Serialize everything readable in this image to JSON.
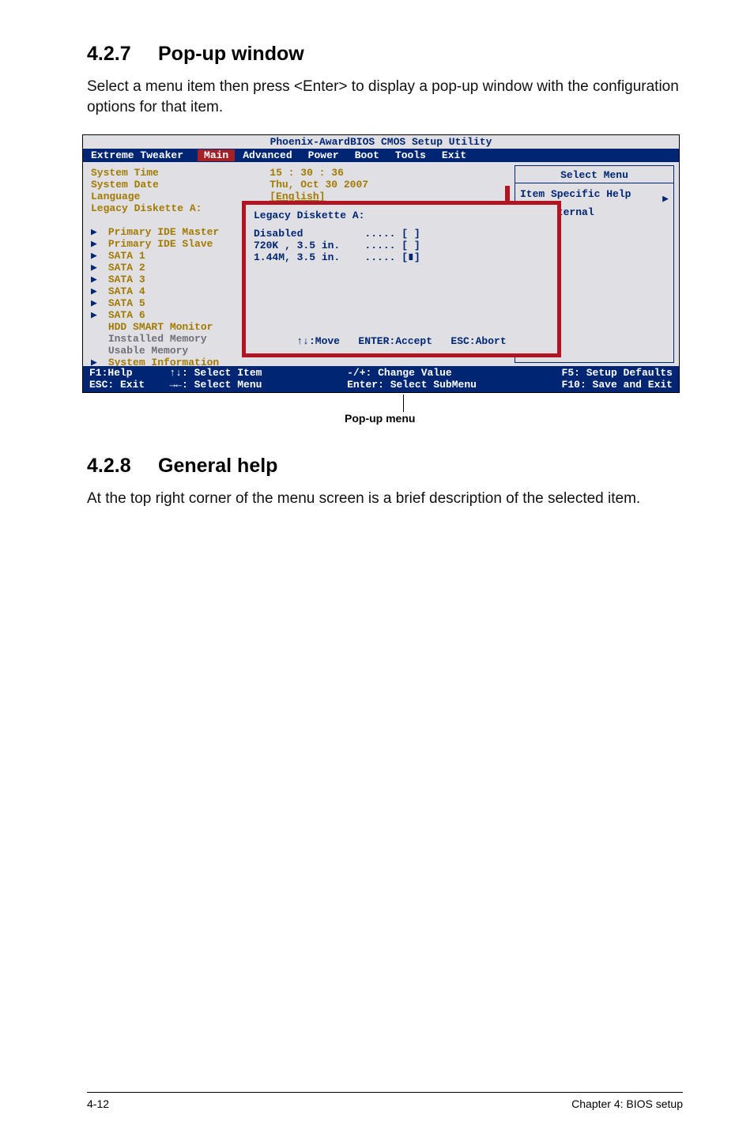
{
  "section1": {
    "num": "4.2.7",
    "title": "Pop-up window"
  },
  "para1": "Select a menu item then press <Enter> to display a pop-up window with the configuration options for that item.",
  "bios": {
    "title": "Phoenix-AwardBIOS CMOS Setup Utility",
    "tabs": [
      "Extreme Tweaker",
      "Main",
      "Advanced",
      "Power",
      "Boot",
      "Tools",
      "Exit"
    ],
    "active_tab": 1,
    "left_rows": [
      {
        "label": "System Time",
        "value": "15 : 30 : 36",
        "yellow": true
      },
      {
        "label": "System Date",
        "value": "Thu, Oct 30 2007",
        "yellow": true
      },
      {
        "label": "Language",
        "value": "[English]",
        "yellow": true
      },
      {
        "label": "Legacy Diskette A:",
        "value": "",
        "yellow": false
      },
      {
        "spacer": true
      },
      {
        "sub": "Primary IDE Master",
        "yellow": true
      },
      {
        "sub": "Primary IDE Slave",
        "yellow": true
      },
      {
        "sub": "SATA 1",
        "yellow": true
      },
      {
        "sub": "SATA 2",
        "yellow": true
      },
      {
        "sub": "SATA 3",
        "yellow": true
      },
      {
        "sub": "SATA 4",
        "yellow": true
      },
      {
        "sub": "SATA 5",
        "yellow": true
      },
      {
        "sub": "SATA 6",
        "yellow": true
      },
      {
        "sub": "HDD SMART Monitor",
        "yellow": true
      },
      {
        "sub": "Installed Memory",
        "dim": true
      },
      {
        "sub": "Usable Memory",
        "dim": true
      },
      {
        "sub": "System Information",
        "yellow": true
      }
    ],
    "right": {
      "title": "Select Menu",
      "body_line1": "Item Specific Help",
      "body_line2": " the internal"
    },
    "popup": {
      "title": "Legacy Diskette A:",
      "options": [
        {
          "name": "Disabled",
          "mark": "[ ]"
        },
        {
          "name": "720K , 3.5 in.",
          "mark": "[ ]"
        },
        {
          "name": "1.44M, 3.5 in.",
          "mark": "[∎]"
        }
      ],
      "help": "↑↓:Move   ENTER:Accept   ESC:Abort"
    },
    "keybar": {
      "c1a": "F1:Help",
      "c1b": "ESC: Exit",
      "c2a": "↑↓: Select Item",
      "c2b": "→←: Select Menu",
      "c3a": "-/+: Change Value",
      "c3b": "Enter: Select SubMenu",
      "c4a": "F5: Setup Defaults",
      "c4b": "F10: Save and Exit"
    }
  },
  "caption": "Pop-up menu",
  "section2": {
    "num": "4.2.8",
    "title": "General help"
  },
  "para2": "At the top right corner of the menu screen is a brief description of the selected item.",
  "footer": {
    "left": "4-12",
    "right": "Chapter 4: BIOS setup"
  }
}
